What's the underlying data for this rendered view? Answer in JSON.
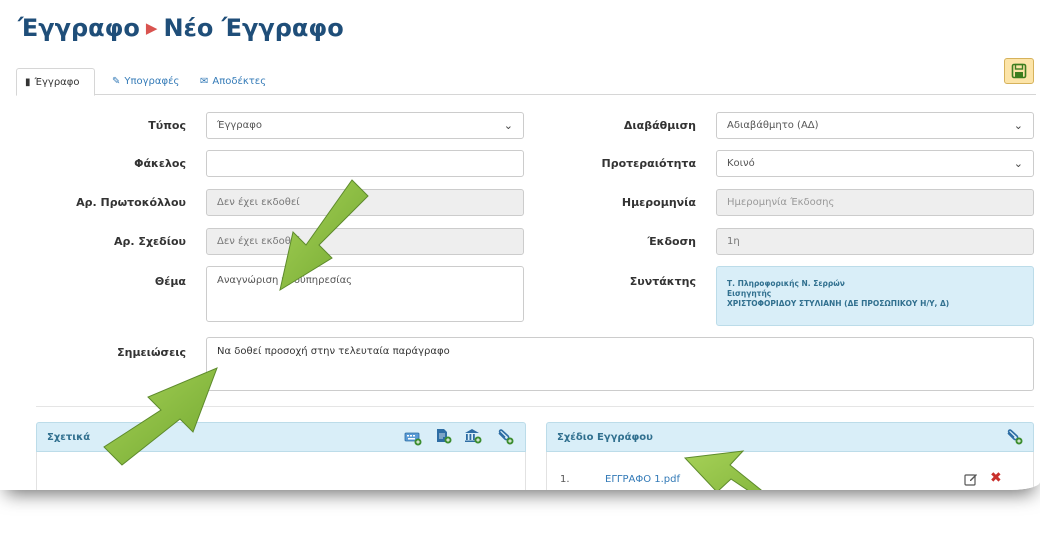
{
  "header": {
    "breadcrumb_root": "Έγγραφο",
    "breadcrumb_current": "Νέο Έγγραφο"
  },
  "tabs": [
    {
      "label": "Έγγραφο",
      "icon": "file-icon"
    },
    {
      "label": "Υπογραφές",
      "icon": "pencil-icon"
    },
    {
      "label": "Αποδέκτες",
      "icon": "envelope-icon"
    }
  ],
  "form": {
    "type_label": "Τύπος",
    "type_value": "Έγγραφο",
    "folder_label": "Φάκελος",
    "folder_value": "",
    "protocol_label": "Αρ. Πρωτοκόλλου",
    "protocol_value": "Δεν έχει εκδοθεί",
    "draft_label": "Αρ. Σχεδίου",
    "draft_value": "Δεν έχει εκδοθεί",
    "subject_label": "Θέμα",
    "subject_value": "Αναγνώριση προϋπηρεσίας",
    "classification_label": "Διαβάθμιση",
    "classification_value": "Αδιαβάθμητο (ΑΔ)",
    "priority_label": "Προτεραιότητα",
    "priority_value": "Κοινό",
    "date_label": "Ημερομηνία",
    "date_placeholder": "Ημερομηνία Έκδοσης",
    "version_label": "Έκδοση",
    "version_value": "1η",
    "author_label": "Συντάκτης",
    "author_line1": "Τ. Πληροφορικής Ν. Σερρών",
    "author_line2": "Εισηγητής",
    "author_line3": "ΧΡΙΣΤΟΦΟΡΙΔΟΥ ΣΤΥΛΙΑΝΗ (ΔΕ ΠΡΟΣΩΠΙΚΟΥ Η/Υ, Δ)",
    "notes_label": "Σημειώσεις",
    "notes_value": "Να δοθεί προσοχή στην τελευταία παράγραφο"
  },
  "related_panel": {
    "title": "Σχετικά"
  },
  "draft_panel": {
    "title": "Σχέδιο Εγγράφου",
    "rows": [
      {
        "num": "1.",
        "file": "ΕΓΓΡΑΦΟ 1.pdf"
      }
    ]
  },
  "colors": {
    "title": "#1f4e79",
    "link": "#337ab7",
    "panel_bg": "#d9eef8",
    "save_bg": "#fce4a8",
    "arrow": "#8cbf3f",
    "delete": "#c9302c"
  }
}
